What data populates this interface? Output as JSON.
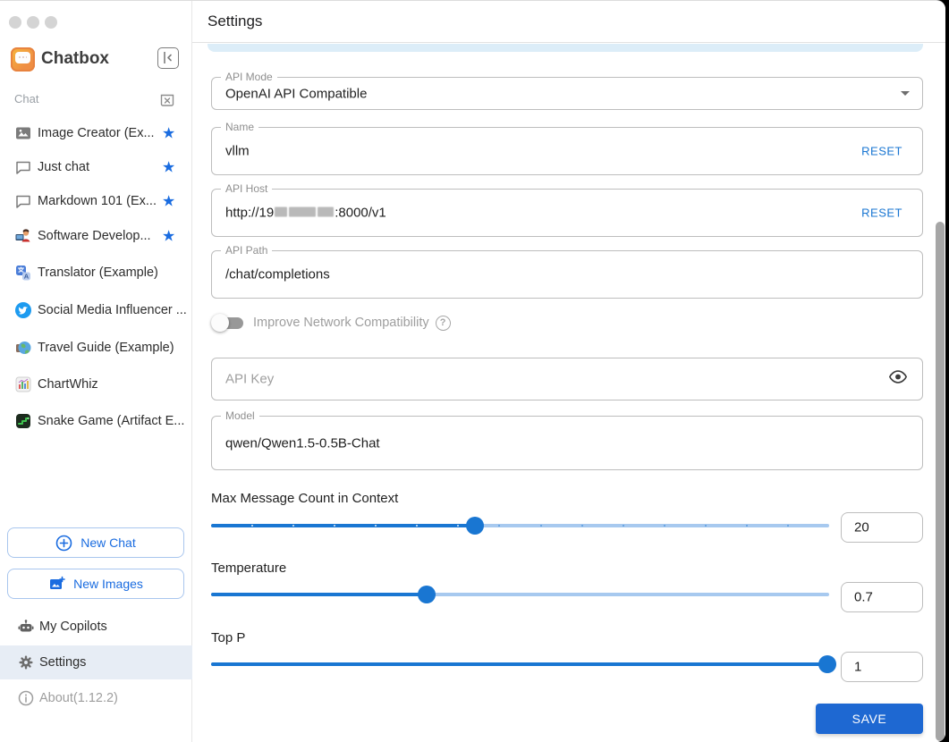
{
  "colors": {
    "accent_blue": "#1a6ce0",
    "slider_blue": "#1976d2",
    "slider_rail": "#a7c9ef",
    "save_button_bg": "#1e68d2",
    "selected_row_bg": "#e7edf5",
    "highlight_strip": "#dcedf8"
  },
  "icons": {
    "star": "★",
    "help": "?"
  },
  "sidebar": {
    "brand": "Chatbox",
    "section_label": "Chat",
    "chats": [
      {
        "label": "Image Creator (Ex...",
        "starred": true
      },
      {
        "label": "Just chat",
        "starred": true
      },
      {
        "label": "Markdown 101 (Ex...",
        "starred": true
      },
      {
        "label": "Software Develop...",
        "starred": true
      },
      {
        "label": "Translator (Example)",
        "starred": false
      },
      {
        "label": "Social Media Influencer ...",
        "starred": false
      },
      {
        "label": "Travel Guide (Example)",
        "starred": false
      },
      {
        "label": "ChartWhiz",
        "starred": false
      },
      {
        "label": "Snake Game (Artifact E...",
        "starred": false
      }
    ],
    "buttons": {
      "new_chat": "New Chat",
      "new_images": "New Images"
    },
    "nav": {
      "copilots": "My Copilots",
      "settings": "Settings",
      "about": "About(1.12.2)"
    }
  },
  "main": {
    "title": "Settings",
    "api_mode": {
      "label": "API Mode",
      "value": "OpenAI API Compatible"
    },
    "name": {
      "label": "Name",
      "value": "vllm",
      "action": "RESET"
    },
    "api_host": {
      "label": "API Host",
      "prefix": "http://19",
      "suffix": ":8000/v1",
      "action": "RESET"
    },
    "api_path": {
      "label": "API Path",
      "value": "/chat/completions"
    },
    "network_toggle": {
      "label": "Improve Network Compatibility",
      "state": "off"
    },
    "api_key": {
      "placeholder": "API Key"
    },
    "model": {
      "label": "Model",
      "value": "qwen/Qwen1.5-0.5B-Chat"
    },
    "sliders": [
      {
        "label": "Max Message Count in Context",
        "value": "20",
        "percent": 42.7,
        "marks": 15
      },
      {
        "label": "Temperature",
        "value": "0.7",
        "percent": 34.9,
        "marks": 0
      },
      {
        "label": "Top P",
        "value": "1",
        "percent": 99.7,
        "marks": 0
      }
    ],
    "save_label": "SAVE"
  }
}
